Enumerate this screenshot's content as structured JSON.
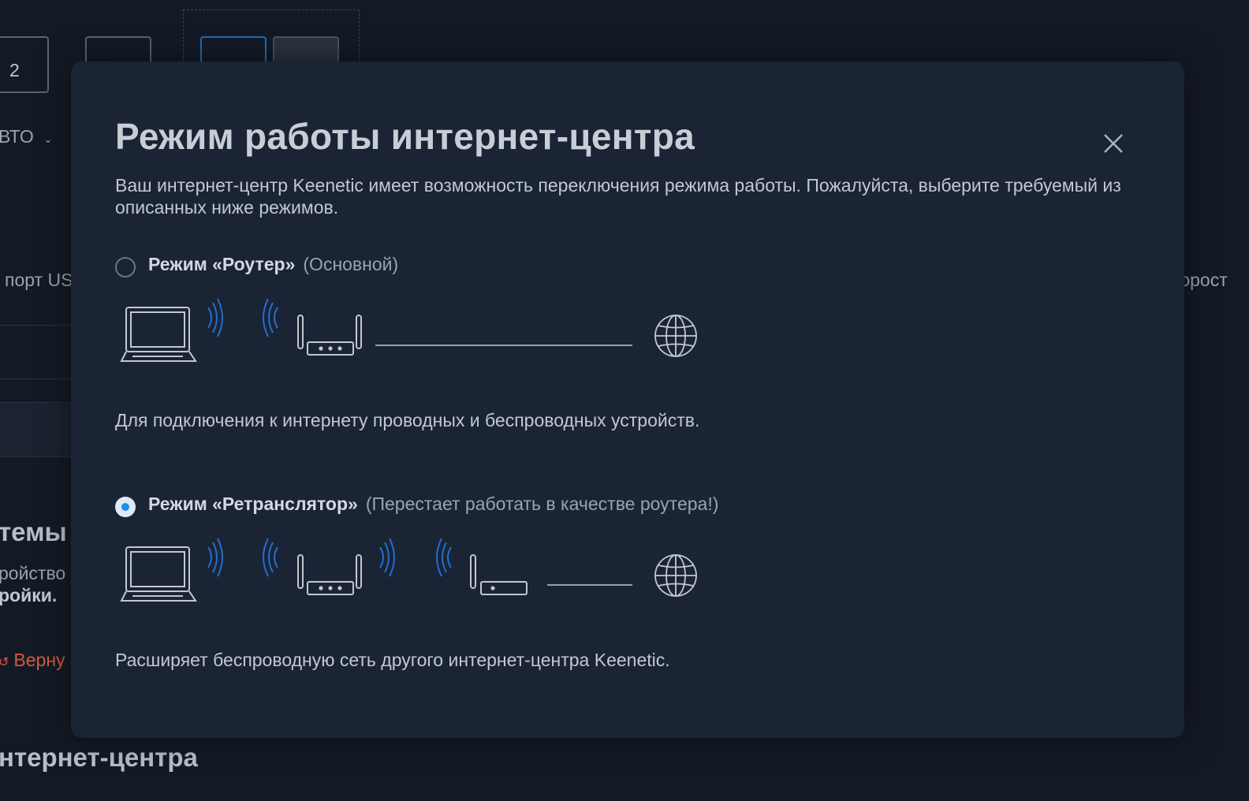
{
  "background": {
    "port_number": "2",
    "mode_select": "ВТО",
    "usb_port_text": "порт US",
    "speed_text": "корост",
    "systems_heading": "темы",
    "device_text": "ройство",
    "settings_text": "ройки.",
    "return_link": "Верну",
    "bottom_heading": "нтернет-центра"
  },
  "modal": {
    "title": "Режим работы интернет-центра",
    "description": "Ваш интернет-центр Keenetic имеет возможность переключения режима работы. Пожалуйста, выберите требуемый из описанных ниже режимов.",
    "options": [
      {
        "name": "Режим «Роутер»",
        "note": "(Основной)",
        "checked": false,
        "caption": "Для подключения к интернету проводных и беспроводных устройств."
      },
      {
        "name": "Режим «Ретранслятор»",
        "note": "(Перестает работать в качестве роутера!)",
        "checked": true,
        "caption": "Расширяет беспроводную сеть другого интернет-центра Keenetic."
      }
    ]
  },
  "colors": {
    "accent": "#1e8ee8",
    "wifi_waves": "#1f6fd1",
    "error_link": "#d9573f"
  }
}
